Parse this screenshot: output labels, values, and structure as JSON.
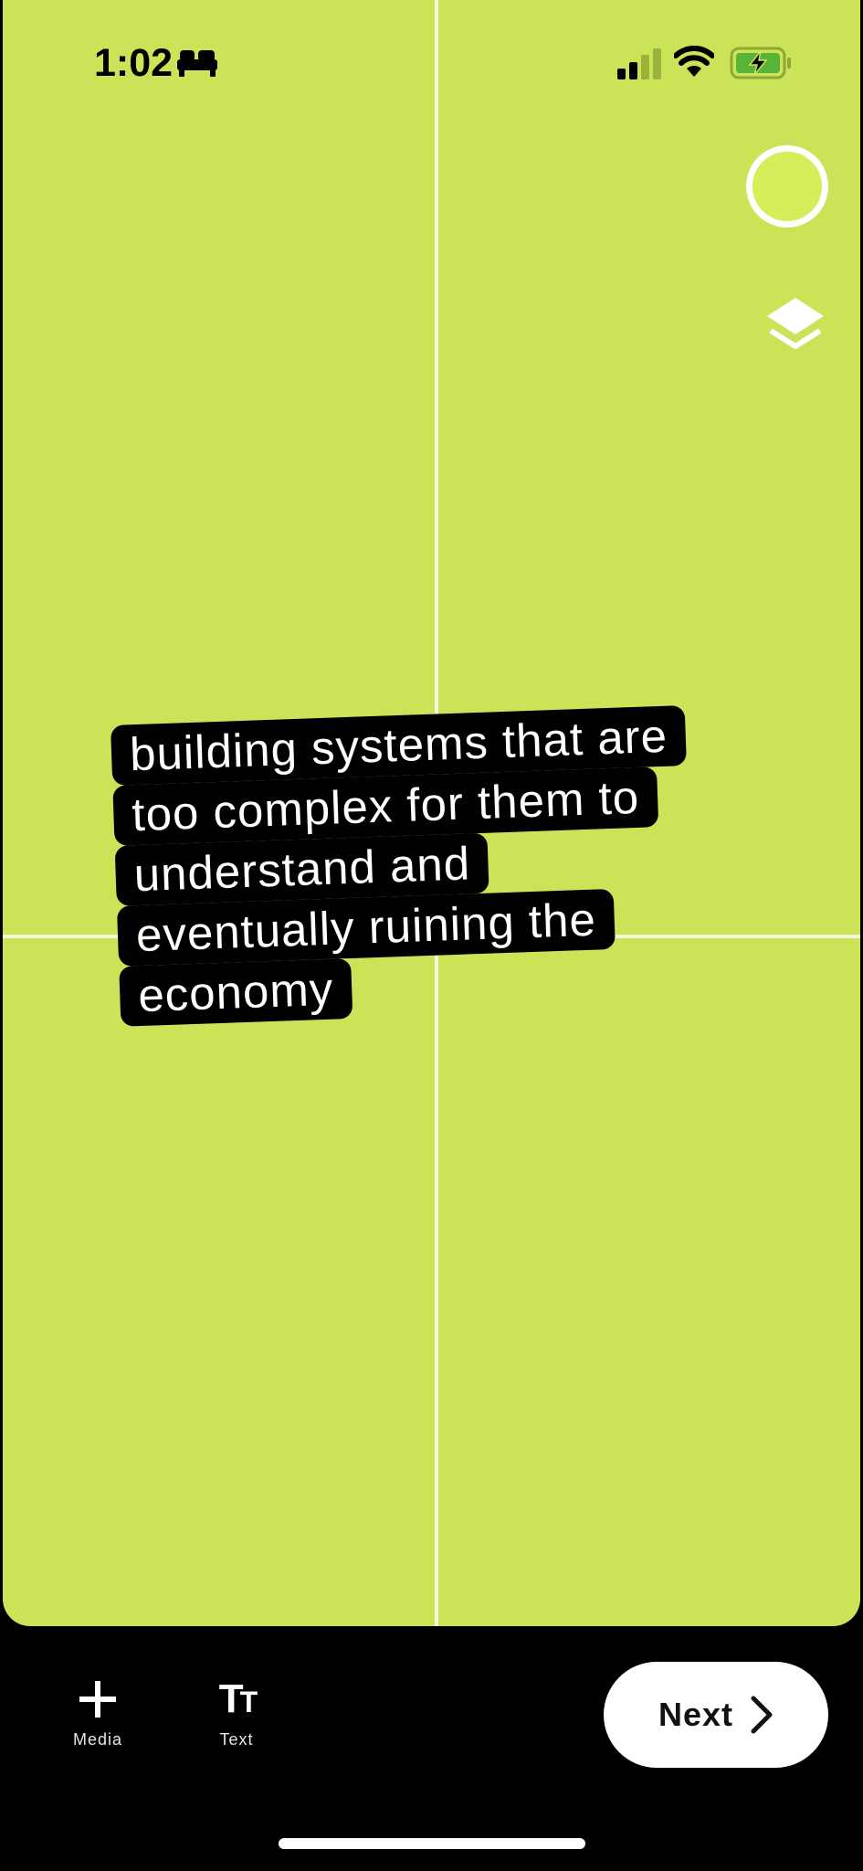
{
  "status_bar": {
    "time": "1:02",
    "focus_icon": "bed-icon",
    "signal_icon": "cellular-signal-icon",
    "wifi_icon": "wifi-icon",
    "battery_icon": "battery-charging-icon"
  },
  "canvas": {
    "background_color": "#cbe357",
    "guide_color": "#f3f7d8"
  },
  "side_controls": {
    "color_picker_icon": "color-circle-icon",
    "color_picker_value": "#d5ee5a",
    "layers_icon": "layers-icon"
  },
  "caption": {
    "lines": [
      "building systems that are",
      "too complex for them to",
      "understand and",
      "eventually ruining the",
      "economy"
    ],
    "text_color": "#ffffff",
    "background_color": "#000000"
  },
  "toolbar": {
    "media_label": "Media",
    "media_icon": "plus-icon",
    "text_label": "Text",
    "text_icon": "text-size-icon",
    "next_label": "Next",
    "next_icon": "chevron-right-icon"
  }
}
